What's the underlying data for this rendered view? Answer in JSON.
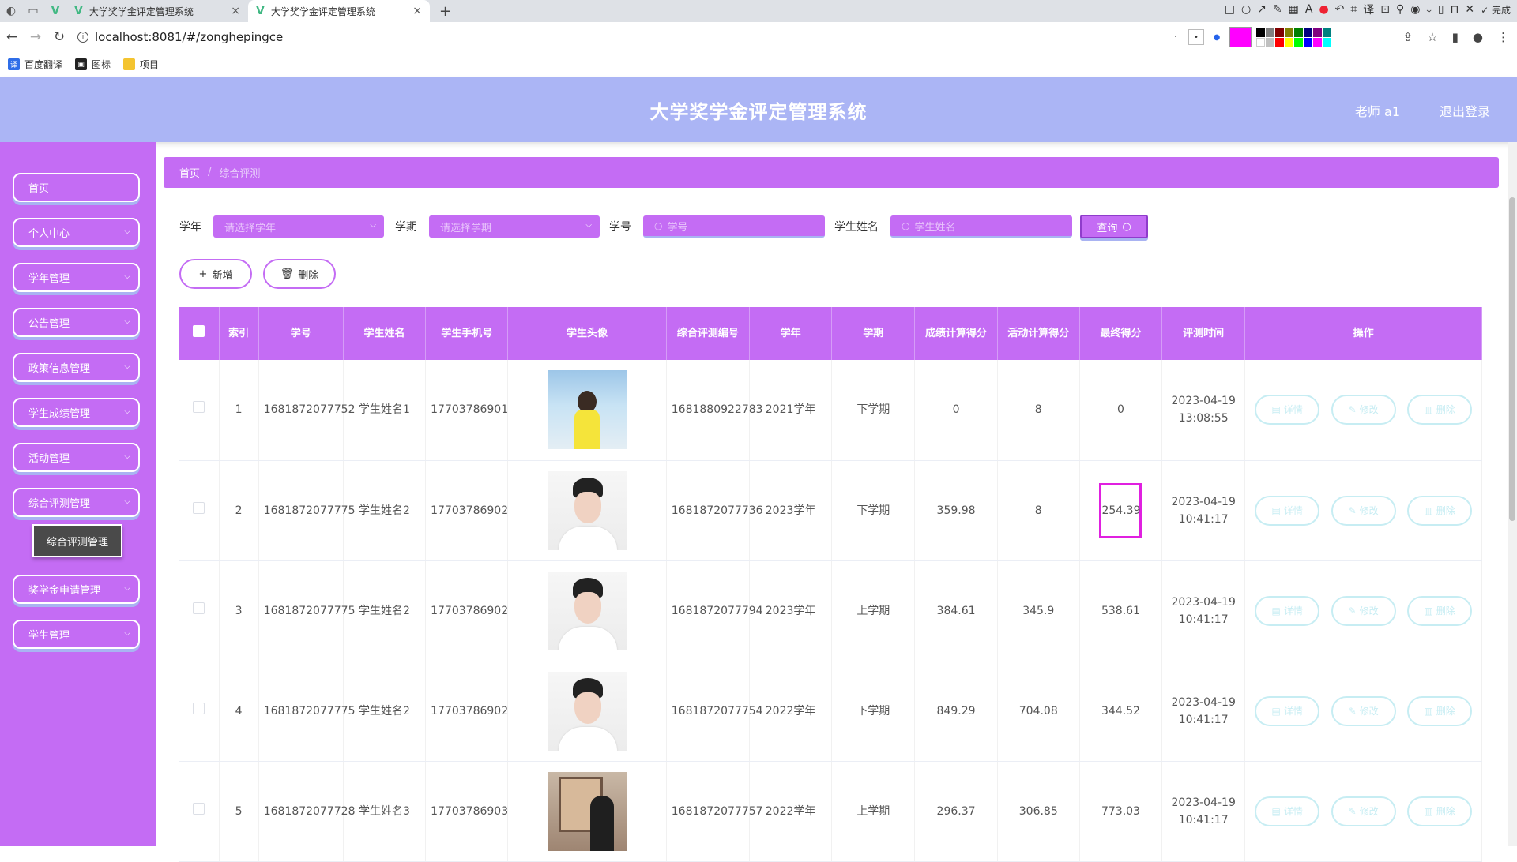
{
  "browser": {
    "tabs": [
      {
        "title": "大学奖学金评定管理系统",
        "active": false
      },
      {
        "title": "大学奖学金评定管理系统",
        "active": true
      }
    ],
    "url": "localhost:8081/#/zonghepingce",
    "done_label": "完成",
    "bookmarks": [
      "百度翻译",
      "图标",
      "项目"
    ]
  },
  "header": {
    "title": "大学奖学金评定管理系统",
    "user": "老师 a1",
    "logout": "退出登录"
  },
  "sidebar": {
    "items": [
      {
        "label": "首页",
        "has_children": false
      },
      {
        "label": "个人中心",
        "has_children": true
      },
      {
        "label": "学年管理",
        "has_children": true
      },
      {
        "label": "公告管理",
        "has_children": true
      },
      {
        "label": "政策信息管理",
        "has_children": true
      },
      {
        "label": "学生成绩管理",
        "has_children": true
      },
      {
        "label": "活动管理",
        "has_children": true
      },
      {
        "label": "综合评测管理",
        "has_children": true
      },
      {
        "label": "奖学金申请管理",
        "has_children": true
      },
      {
        "label": "学生管理",
        "has_children": true
      }
    ],
    "submenu_active": "综合评测管理"
  },
  "breadcrumb": {
    "home": "首页",
    "separator": "/",
    "current": "综合评测"
  },
  "filters": {
    "year_label": "学年",
    "year_placeholder": "请选择学年",
    "term_label": "学期",
    "term_placeholder": "请选择学期",
    "id_label": "学号",
    "id_placeholder": "学号",
    "name_label": "学生姓名",
    "name_placeholder": "学生姓名",
    "query_button": "查询"
  },
  "actions": {
    "add": "新增",
    "delete": "删除"
  },
  "table": {
    "columns": [
      "索引",
      "学号",
      "学生姓名",
      "学生手机号",
      "学生头像",
      "综合评测编号",
      "学年",
      "学期",
      "成绩计算得分",
      "活动计算得分",
      "最终得分",
      "评测时间",
      "操作"
    ],
    "row_actions": {
      "detail": "详情",
      "edit": "修改",
      "delete": "删除"
    },
    "rows": [
      {
        "index": "1",
        "student_id": "1681872077752",
        "name": "学生姓名1",
        "phone": "17703786901",
        "avatar": "girl",
        "eval_id": "1681880922783",
        "year": "2021学年",
        "term": "下学期",
        "grade_score": "0",
        "activity_score": "8",
        "final_score": "0",
        "time": "2023-04-19 13:08:55"
      },
      {
        "index": "2",
        "student_id": "1681872077775",
        "name": "学生姓名2",
        "phone": "17703786902",
        "avatar": "boy",
        "eval_id": "1681872077736",
        "year": "2023学年",
        "term": "下学期",
        "grade_score": "359.98",
        "activity_score": "8",
        "final_score": "254.39",
        "time": "2023-04-19 10:41:17"
      },
      {
        "index": "3",
        "student_id": "1681872077775",
        "name": "学生姓名2",
        "phone": "17703786902",
        "avatar": "boy",
        "eval_id": "1681872077794",
        "year": "2023学年",
        "term": "上学期",
        "grade_score": "384.61",
        "activity_score": "345.9",
        "final_score": "538.61",
        "time": "2023-04-19 10:41:17"
      },
      {
        "index": "4",
        "student_id": "1681872077775",
        "name": "学生姓名2",
        "phone": "17703786902",
        "avatar": "boy",
        "eval_id": "1681872077754",
        "year": "2022学年",
        "term": "下学期",
        "grade_score": "849.29",
        "activity_score": "704.08",
        "final_score": "344.52",
        "time": "2023-04-19 10:41:17"
      },
      {
        "index": "5",
        "student_id": "1681872077728",
        "name": "学生姓名3",
        "phone": "17703786903",
        "avatar": "art",
        "eval_id": "1681872077757",
        "year": "2022学年",
        "term": "上学期",
        "grade_score": "296.37",
        "activity_score": "306.85",
        "final_score": "773.03",
        "time": "2023-04-19 10:41:17"
      }
    ]
  },
  "colors": {
    "header_bg": "#abb5f5",
    "accent_purple": "#c46cf4",
    "row_button": "#c7edf3",
    "highlight_box": "#e020e0"
  }
}
